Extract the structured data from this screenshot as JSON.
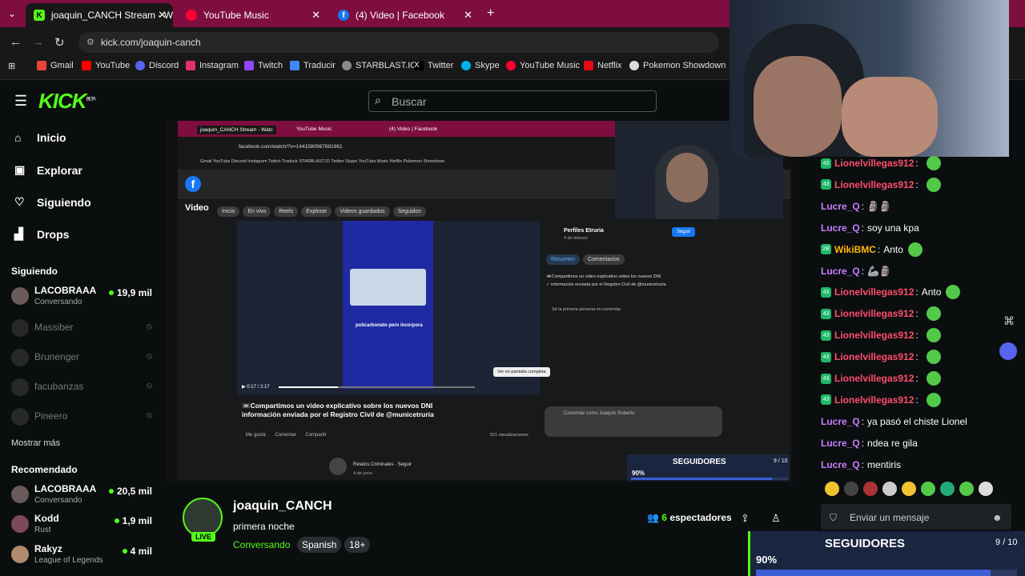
{
  "browser": {
    "tabs": [
      {
        "label": "joaquin_CANCH Stream - Watc",
        "icon": "K"
      },
      {
        "label": "YouTube Music",
        "icon": "youtube-music"
      },
      {
        "label": "(4) Video | Facebook",
        "icon": "facebook"
      }
    ],
    "url": "kick.com/joaquin-canch",
    "bookmarks": [
      "Gmail",
      "YouTube",
      "Discord",
      "Instagram",
      "Twitch",
      "Traducir",
      "STARBLAST.IO",
      "Twitter",
      "Skype",
      "YouTube Music",
      "Netflix",
      "Pokemon Showdown"
    ]
  },
  "kick": {
    "logo": "KICK",
    "logo_sup": "BETA",
    "search_placeholder": "Buscar",
    "nav": [
      "Inicio",
      "Explorar",
      "Siguiendo",
      "Drops"
    ],
    "following_title": "Siguiendo",
    "following": [
      {
        "name": "LACOBRAAA",
        "sub": "Conversando",
        "viewers": "19,9 mil",
        "live": true
      },
      {
        "name": "Massiber",
        "live": false
      },
      {
        "name": "Brunenger",
        "live": false
      },
      {
        "name": "facubanzas",
        "live": false
      },
      {
        "name": "Pineero",
        "live": false
      }
    ],
    "show_more": "Mostrar más",
    "recommended_title": "Recomendado",
    "recommended": [
      {
        "name": "LACOBRAAA",
        "sub": "Conversando",
        "viewers": "20,5 mil"
      },
      {
        "name": "Kodd",
        "sub": "Rust",
        "viewers": "1,9 mil"
      },
      {
        "name": "Rakyz",
        "sub": "League of Legends",
        "viewers": "4 mil"
      }
    ]
  },
  "stream_capture": {
    "inner_tabs": [
      "joaquin_CANCH Stream - Watc",
      "YouTube Music",
      "(4) Video | Facebook"
    ],
    "inner_url": "facebook.com/watch/?v=1441580967681961",
    "inner_bookmarks": "Gmail  YouTube  Discord  Instagram  Twitch  Traducir  STARBLAST.IO  Twitter  Skype  YouTube Music  Netflix  Pokemon Showdown",
    "fb_section": "Video",
    "fb_pills": [
      "Inicio",
      "En vivo",
      "Reels",
      "Explorar",
      "Videos guardados",
      "Seguidos"
    ],
    "fb_page": "Perfiles Etruria",
    "fb_date": "4 de febrero",
    "fb_follow": "Seguir",
    "fb_tabs": [
      "Resumen",
      "Comentarios"
    ],
    "fb_desc1": "📼Compartimos un video explicativo sobre los nuevos DNI",
    "fb_desc2": "✓ información enviada por el Registro Civil de @municetruria",
    "fb_first": "Sé la primera persona en comentar.",
    "fb_video_caption": "policarbonato pero incorpora",
    "fb_time": "0:17 / 2:17",
    "fb_tooltip": "Ver en pantalla completa",
    "fb_title1": "📼Compartimos un video explicativo sobre los nuevos DNI",
    "fb_title2": "información enviada por el Registro Civil de @municetruria",
    "fb_actions": [
      "Me gusta",
      "Comentar",
      "Compartir"
    ],
    "fb_views": "521 visualizaciones",
    "fb_comment_as": "Comentar como Joaquin Roberto",
    "fb_next": "Relatos Criminales · Seguir",
    "fb_next_date": "4 de junio"
  },
  "goal": {
    "title": "SEGUIDORES",
    "count": "9 / 10",
    "percent": "90%",
    "fill": 0.9
  },
  "channel": {
    "name": "joaquin_CANCH",
    "title": "primera noche",
    "category": "Conversando",
    "tags": [
      "Spanish",
      "18+"
    ],
    "live": "LIVE",
    "viewers": "6",
    "viewers_label": "espectadores"
  },
  "chat": {
    "messages": [
      {
        "user": "Lionelvillegas912",
        "text": "",
        "color": "#ff4d6d",
        "badge": "43"
      },
      {
        "user": "Lionelvillegas912",
        "text": "",
        "color": "#ff4d6d",
        "badge": "43"
      },
      {
        "user": "Lucre_Q",
        "text": "🗿🗿",
        "color": "#c77dff"
      },
      {
        "user": "Lucre_Q",
        "text": "soy una kpa",
        "color": "#c77dff"
      },
      {
        "user": "WikiBMC",
        "text": "Anto",
        "color": "#ffb703",
        "badge": "2B"
      },
      {
        "user": "Lucre_Q",
        "text": "🦾🗿",
        "color": "#c77dff"
      },
      {
        "user": "Lionelvillegas912",
        "text": "Anto",
        "color": "#ff4d6d",
        "badge": "43"
      },
      {
        "user": "Lionelvillegas912",
        "text": "",
        "color": "#ff4d6d",
        "badge": "43"
      },
      {
        "user": "Lionelvillegas912",
        "text": "",
        "color": "#ff4d6d",
        "badge": "43"
      },
      {
        "user": "Lionelvillegas912",
        "text": "",
        "color": "#ff4d6d",
        "badge": "43"
      },
      {
        "user": "Lionelvillegas912",
        "text": "",
        "color": "#ff4d6d",
        "badge": "43"
      },
      {
        "user": "Lionelvillegas912",
        "text": "",
        "color": "#ff4d6d",
        "badge": "43"
      },
      {
        "user": "Lucre_Q",
        "text": "ya pasó el chiste Lionel",
        "color": "#c77dff"
      },
      {
        "user": "Lucre_Q",
        "text": "ndea re gila",
        "color": "#c77dff"
      },
      {
        "user": "Lucre_Q",
        "text": "mentiris",
        "color": "#c77dff"
      }
    ],
    "input_placeholder": "Enviar un mensaje"
  }
}
